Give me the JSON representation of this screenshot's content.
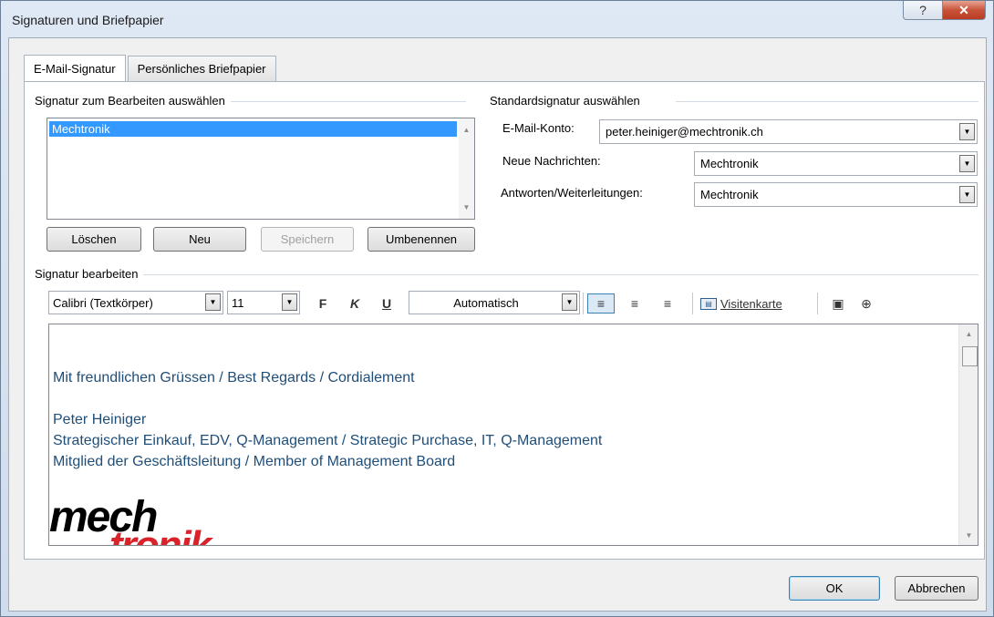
{
  "window": {
    "title": "Signaturen und Briefpapier",
    "help_glyph": "?",
    "close_glyph": "✕"
  },
  "tabs": [
    {
      "label": "E-Mail-Signatur",
      "active": true
    },
    {
      "label": "Persönliches Briefpapier",
      "active": false
    }
  ],
  "signature_select": {
    "group_label": "Signatur zum Bearbeiten auswählen",
    "items": [
      "Mechtronik"
    ],
    "selected": "Mechtronik",
    "buttons": {
      "delete": "Löschen",
      "new": "Neu",
      "save": "Speichern",
      "rename": "Umbenennen"
    }
  },
  "default_signature": {
    "group_label": "Standardsignatur auswählen",
    "account_label": "E-Mail-Konto:",
    "account_value": "peter.heiniger@mechtronik.ch",
    "new_messages_label": "Neue Nachrichten:",
    "new_messages_value": "Mechtronik",
    "replies_label": "Antworten/Weiterleitungen:",
    "replies_value": "Mechtronik"
  },
  "edit": {
    "group_label": "Signatur bearbeiten",
    "font": "Calibri (Textkörper)",
    "size": "11",
    "bold": "F",
    "italic": "K",
    "underline": "U",
    "color": "Automatisch",
    "business_card": "Visitenkarte",
    "lines": [
      "Mit freundlichen Grüssen / Best Regards / Cordialement",
      "Peter Heiniger",
      "Strategischer Einkauf, EDV, Q-Management / Strategic Purchase, IT, Q-Management",
      "Mitglied der Geschäftsleitung / Member of Management Board"
    ],
    "logo_top": "mech",
    "logo_bottom": "tronik",
    "text_color": "#1f4e79",
    "logo_accent": "#d8232a"
  },
  "footer": {
    "ok": "OK",
    "cancel": "Abbrechen"
  }
}
